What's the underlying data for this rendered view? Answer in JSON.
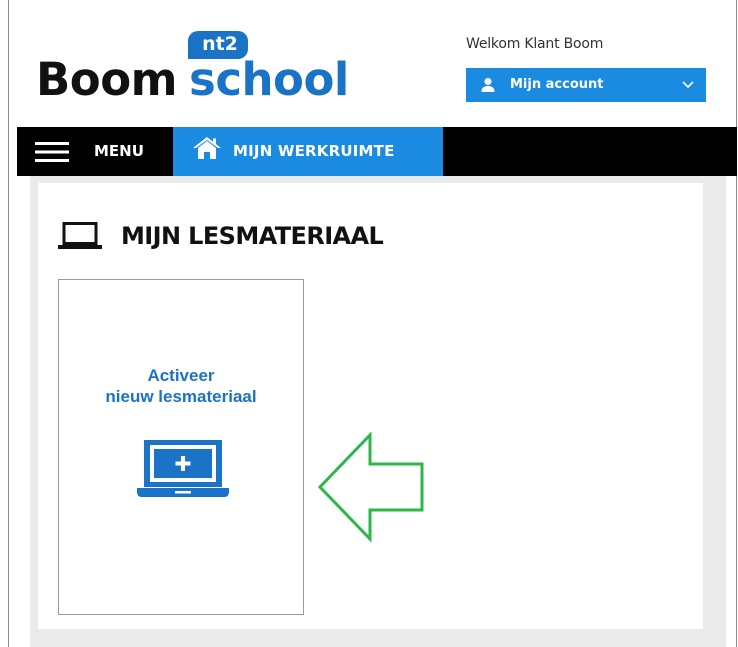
{
  "logo": {
    "brand_primary": "Boom",
    "brand_secondary": "school",
    "badge": "nt2",
    "colors": {
      "dark": "#111111",
      "blue": "#1a73c7"
    }
  },
  "account": {
    "welcome": "Welkom Klant Boom",
    "button_label": "Mijn account",
    "icons": [
      "user-icon",
      "chevron-down-icon"
    ],
    "color": "#1a8be0"
  },
  "nav": {
    "menu_label": "MENU",
    "workspace_label": "MIJN WERKRUIMTE",
    "icons": [
      "hamburger-icon",
      "home-icon"
    ]
  },
  "main": {
    "section_title": "MIJN LESMATERIAAL",
    "section_icon": "laptop-icon",
    "card": {
      "line1": "Activeer",
      "line2": "nieuw lesmateriaal",
      "icon": "laptop-plus-icon"
    }
  },
  "annotation": {
    "arrow_color": "#2fb64a",
    "arrow_direction": "left"
  }
}
